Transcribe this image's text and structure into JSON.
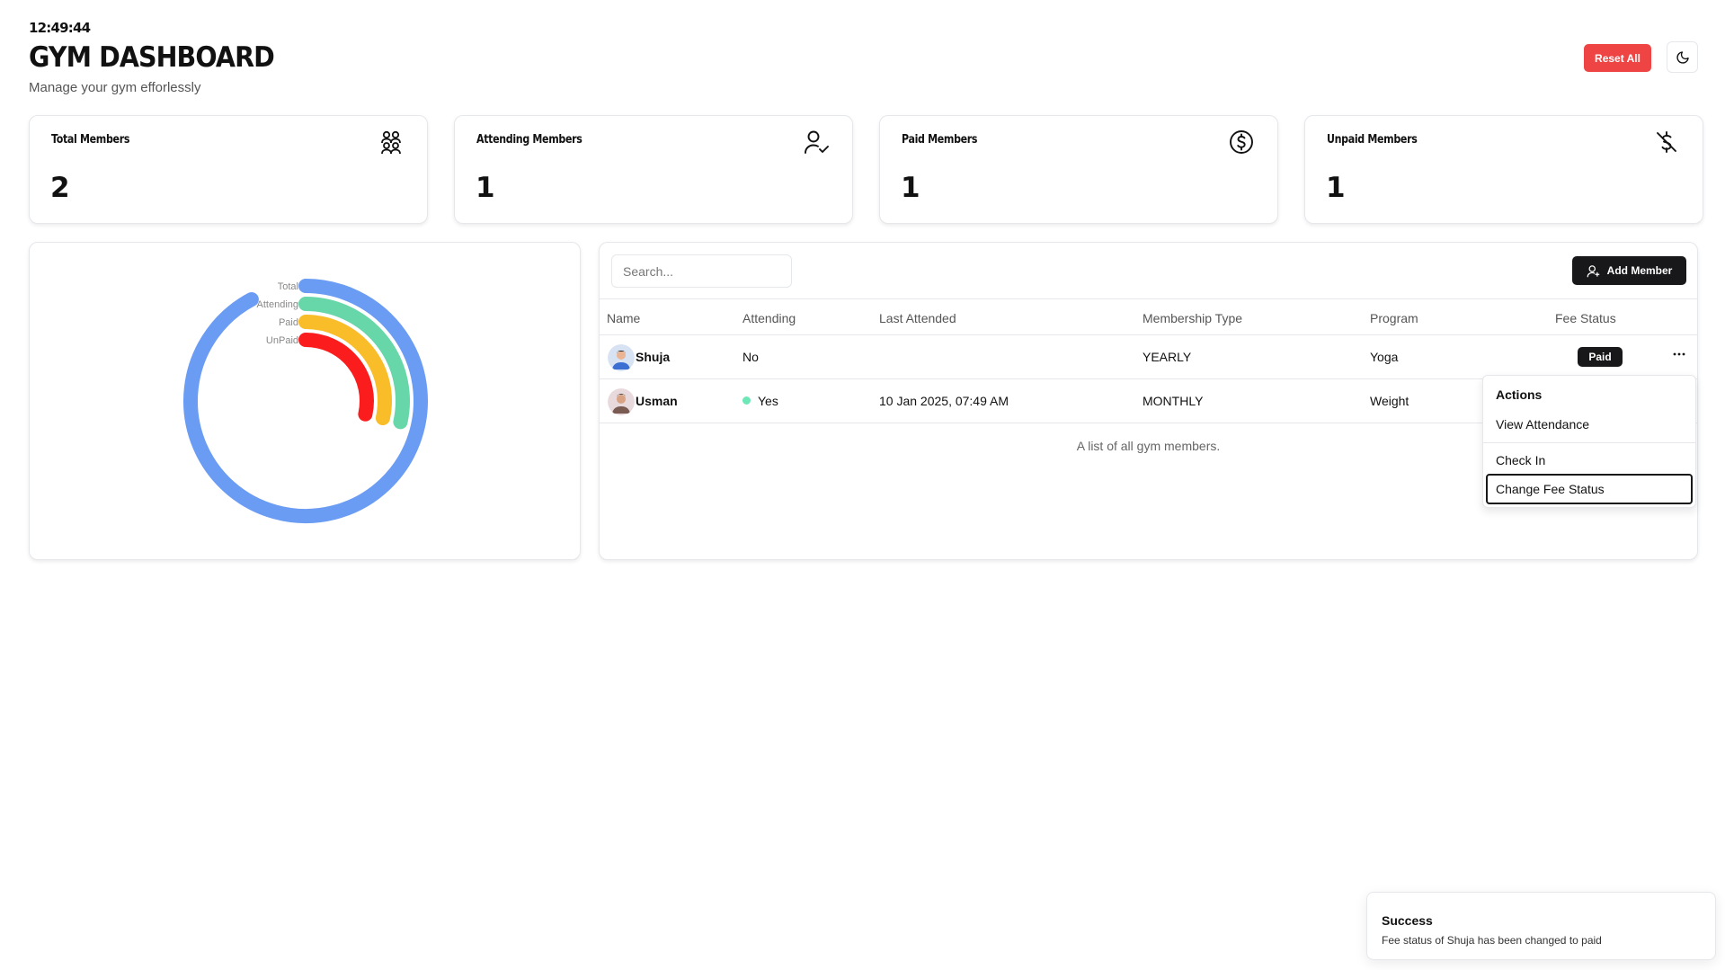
{
  "header": {
    "clock": "12:49:44",
    "title": "GYM DASHBOARD",
    "subtitle": "Manage your gym efforlessly",
    "reset_label": "Reset All"
  },
  "stats": [
    {
      "label": "Total Members",
      "value": "2",
      "icon": "users-group-icon"
    },
    {
      "label": "Attending Members",
      "value": "1",
      "icon": "user-check-icon"
    },
    {
      "label": "Paid Members",
      "value": "1",
      "icon": "dollar-circle-icon"
    },
    {
      "label": "Unpaid Members",
      "value": "1",
      "icon": "dollar-off-icon"
    }
  ],
  "chart_data": {
    "type": "radial-bar",
    "categories": [
      "Total",
      "Attending",
      "Paid",
      "UnPaid"
    ],
    "values": [
      2,
      1,
      1,
      1
    ],
    "colors": [
      "#6b9cf4",
      "#67d6a8",
      "#f8bd29",
      "#fb1d1d"
    ]
  },
  "table": {
    "search_placeholder": "Search...",
    "add_label": "Add Member",
    "columns": [
      "Name",
      "Attending",
      "Last Attended",
      "Membership Type",
      "Program",
      "Fee Status"
    ],
    "rows": [
      {
        "name": "Shuja",
        "attending": "No",
        "last_attended": "",
        "membership": "YEARLY",
        "program": "Yoga",
        "fee_status": "Paid"
      },
      {
        "name": "Usman",
        "attending": "Yes",
        "last_attended": "10 Jan 2025, 07:49 AM",
        "membership": "MONTHLY",
        "program": "Weight",
        "fee_status": ""
      }
    ],
    "caption": "A list of all gym members."
  },
  "menu": {
    "heading": "Actions",
    "items": [
      "View Attendance",
      "Check In",
      "Change Fee Status"
    ]
  },
  "toast": {
    "title": "Success",
    "description": "Fee status of Shuja has been changed to paid"
  },
  "colors": {
    "danger": "#ef4444",
    "dark": "#18181b",
    "attending": "#6ee7b7"
  }
}
